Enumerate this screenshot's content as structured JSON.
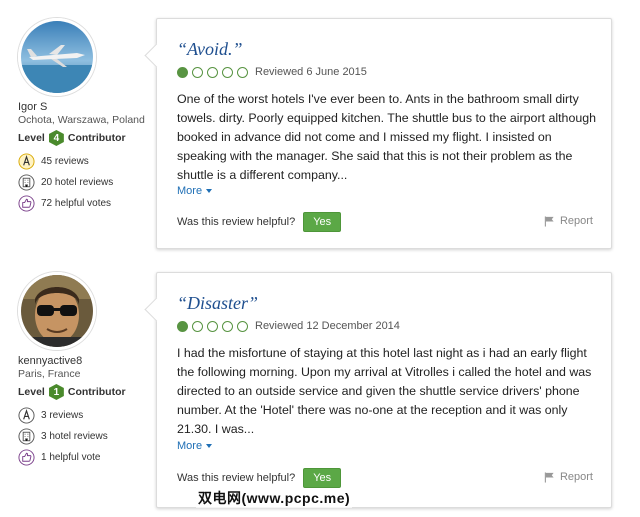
{
  "reviews": [
    {
      "reviewer": {
        "name": "Igor S",
        "location": "Ochota, Warszawa, Poland",
        "level_label": "Level",
        "level_number": "4",
        "level_title": "Contributor",
        "stats": [
          "45 reviews",
          "20 hotel reviews",
          "72 helpful votes"
        ]
      },
      "title": "“Avoid.”",
      "rating_bubbles": 1,
      "reviewed": "Reviewed 6 June 2015",
      "body": "One of the worst hotels I've ever been to. Ants in the bathroom small dirty towels. dirty. Poorly equipped kitchen. The shuttle bus to the airport although booked in advance did not come and I missed my flight. I insisted on speaking with the manager. She said that this is not their problem as the shuttle is a different company...",
      "more": "More",
      "helpful_question": "Was this review helpful?",
      "yes": "Yes",
      "report": "Report"
    },
    {
      "reviewer": {
        "name": "kennyactive8",
        "location": "Paris, France",
        "level_label": "Level",
        "level_number": "1",
        "level_title": "Contributor",
        "stats": [
          "3 reviews",
          "3 hotel reviews",
          "1 helpful vote"
        ]
      },
      "title": "“Disaster”",
      "rating_bubbles": 1,
      "reviewed": "Reviewed 12 December 2014",
      "body": "I had the misfortune of staying at this hotel last night as i had an early flight the following morning. Upon my arrival at Vitrolles i called the hotel and was directed to an outside service and given the shuttle service drivers' phone number. At the 'Hotel' there was no-one at the reception and it was only 21.30. I was...",
      "more": "More",
      "helpful_question": "Was this review helpful?",
      "yes": "Yes",
      "report": "Report"
    }
  ],
  "watermark": "双电网(www.pcpc.me)",
  "colors": {
    "accent_green": "#589442",
    "link_blue": "#1f6fb5",
    "title_blue": "#1f4f8f"
  }
}
